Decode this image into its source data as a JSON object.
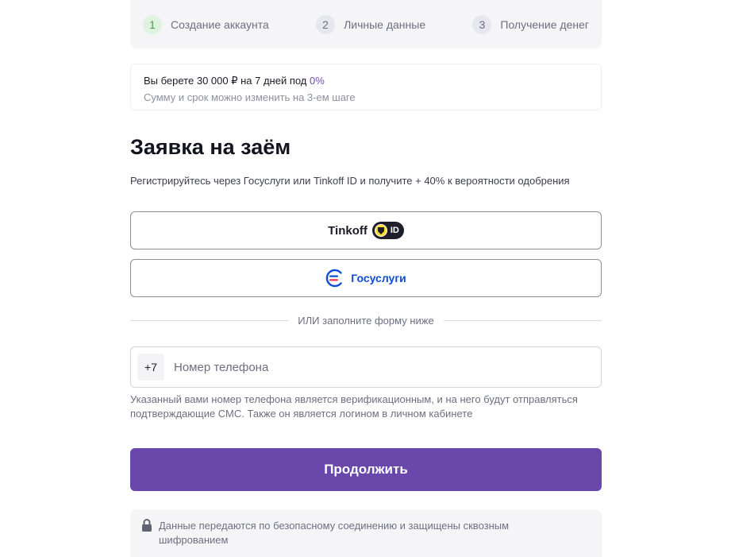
{
  "steps": [
    {
      "num": "1",
      "label": "Создание аккаунта"
    },
    {
      "num": "2",
      "label": "Личные данные"
    },
    {
      "num": "3",
      "label": "Получение денег"
    }
  ],
  "offer": {
    "text_before": "Вы берете 30 000 ₽ на 7 дней под ",
    "rate": "0%",
    "note": "Сумму и срок можно изменить на 3-ем шаге"
  },
  "title": "Заявка на заём",
  "subtitle": "Регистрируйтесь через Госуслуги или Tinkoff ID и получите + 40% к вероятности одобрения",
  "tinkoff": {
    "label": "Tinkoff",
    "badge": "ID"
  },
  "gosuslugi": {
    "label": "Госуслуги"
  },
  "divider_text": "ИЛИ заполните форму ниже",
  "phone": {
    "prefix": "+7",
    "placeholder": "Номер телефона",
    "hint": "Указанный вами номер телефона является верификационным, и на него будут отправляться подтверждающие СМС. Также он является логином в личном кабинете"
  },
  "continue_label": "Продолжить",
  "secure_note": "Данные передаются по безопасному соединению и защищены сквозным шифрованием",
  "colors": {
    "accent": "#6a48ab",
    "active_step_bg": "#dff2df",
    "gosuslugi_blue": "#0d4cd3",
    "gosuslugi_red": "#ee2f53"
  }
}
